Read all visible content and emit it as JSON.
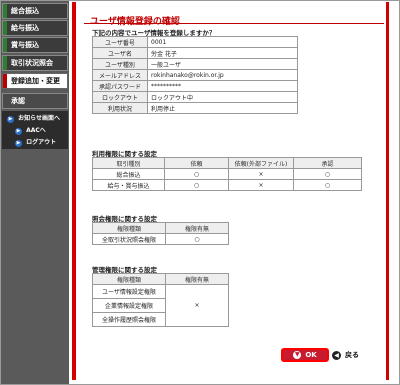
{
  "sidebar": {
    "items": [
      {
        "label": "総合振込"
      },
      {
        "label": "給与振込"
      },
      {
        "label": "賞与振込"
      },
      {
        "label": "取引状況照会"
      },
      {
        "label": "登録追加・変更"
      },
      {
        "label": "承認"
      }
    ],
    "subitems": [
      {
        "label": "お知らせ画面へ"
      },
      {
        "label": "AACへ"
      },
      {
        "label": "ログアウト"
      }
    ]
  },
  "main": {
    "title": "ユーザ情報登録の確認",
    "instruction": "下記の内容でユーザ情報を登録しますか？",
    "user_info": [
      {
        "label": "ユーザ番号",
        "value": "0001"
      },
      {
        "label": "ユーザ名",
        "value": "労金 花子"
      },
      {
        "label": "ユーザ種別",
        "value": "一般ユーザ"
      },
      {
        "label": "メールアドレス",
        "value": "rokinhanako@rokin.or.jp"
      },
      {
        "label": "承認パスワード",
        "value": "**********"
      },
      {
        "label": "ロックアウト",
        "value": "ロックアウト中"
      },
      {
        "label": "利用状況",
        "value": "利用停止"
      }
    ],
    "usage_section_title": "利用権限に関する設定",
    "usage_table": {
      "headers": [
        "取引種別",
        "依頼",
        "依頼(外部ファイル)",
        "承認"
      ],
      "rows": [
        {
          "type": "総合振込",
          "request": "○",
          "request_file": "×",
          "approve": "○"
        },
        {
          "type": "給与・賞与振込",
          "request": "○",
          "request_file": "×",
          "approve": "○"
        }
      ]
    },
    "inquiry_section_title": "照会権限に関する設定",
    "inquiry_table": {
      "headers": [
        "権限種類",
        "権限有無"
      ],
      "rows": [
        {
          "type": "全取引状況照会権限",
          "value": "○"
        }
      ]
    },
    "admin_section_title": "管理権限に関する設定",
    "admin_table": {
      "headers": [
        "権限種類",
        "権限有無"
      ],
      "rows": [
        {
          "type": "ユーザ情報設定権限"
        },
        {
          "type": "企業情報設定権限"
        },
        {
          "type": "全操作履歴照会権限"
        }
      ],
      "value": "×"
    },
    "ok_label": "OK",
    "back_label": "戻る"
  },
  "icons": {
    "ok": "check-circle-icon",
    "back": "back-arrow-icon",
    "menu_sub": "circle-arrow-icon"
  },
  "colors": {
    "accent_red": "#d40000",
    "ok_button": "#c81c2e",
    "sidebar_bg": "#3b3b3b"
  }
}
